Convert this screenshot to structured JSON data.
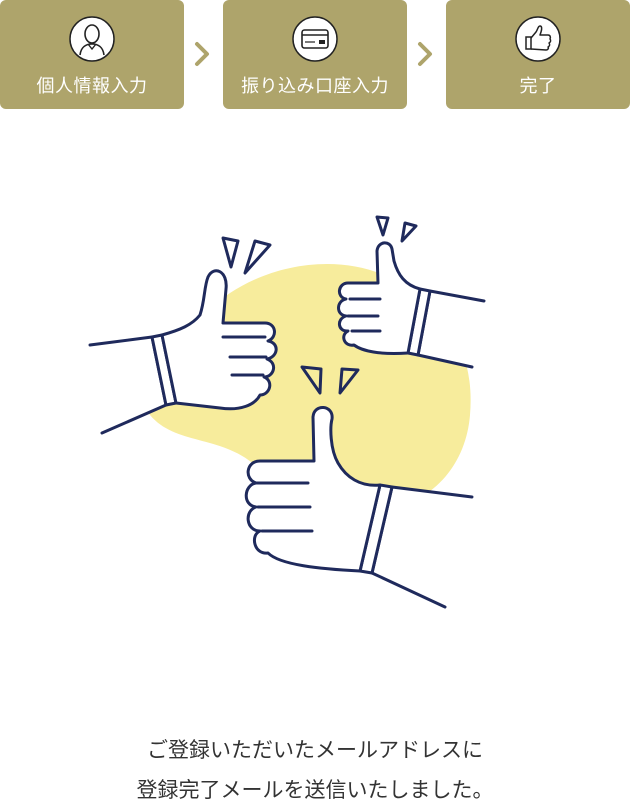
{
  "steps": [
    {
      "label": "個人情報入力",
      "icon": "person-icon",
      "state": "done"
    },
    {
      "label": "振り込み口座入力",
      "icon": "bank-card-icon",
      "state": "done"
    },
    {
      "label": "完了",
      "icon": "thumbs-up-icon",
      "state": "current"
    }
  ],
  "separator_icon": "chevron-right-icon",
  "illustration": {
    "icon": "three-thumbs-up-illustration",
    "blob_color": "#f7ec9c",
    "line_color": "#1f2a5c"
  },
  "message": {
    "line1": "ご登録いただいたメールアドレスに",
    "line2": "登録完了メールを送信いたしました。"
  },
  "colors": {
    "step_bg": "#aea46b",
    "step_text": "#ffffff",
    "chevron": "#aea46b",
    "message_text": "#333333"
  }
}
